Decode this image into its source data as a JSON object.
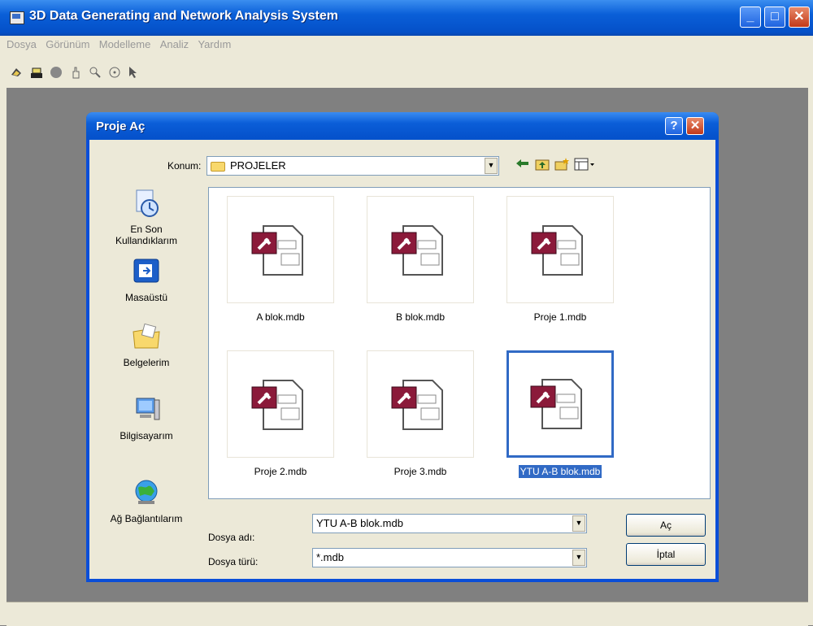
{
  "app": {
    "title": "3D Data Generating and Network Analysis System",
    "menu": [
      "Dosya",
      "Görünüm",
      "Modelleme",
      "Analiz",
      "Yardım"
    ],
    "window_buttons": {
      "minimize": "_",
      "maximize": "□",
      "close": "✕"
    }
  },
  "toolbar": {
    "icons": [
      "open-project-icon",
      "table-icon",
      "stop-icon",
      "pan-icon",
      "zoom-icon",
      "target-icon",
      "pointer-icon"
    ]
  },
  "dialog": {
    "title": "Proje Aç",
    "help_label": "?",
    "close_label": "✕",
    "location_label": "Konum:",
    "location_value": "PROJELER",
    "places": [
      {
        "label1": "En Son",
        "label2": "Kullandıklarım",
        "icon": "recent-icon"
      },
      {
        "label1": "Masaüstü",
        "label2": "",
        "icon": "desktop-icon"
      },
      {
        "label1": "Belgelerim",
        "label2": "",
        "icon": "my-documents-icon"
      },
      {
        "label1": "Bilgisayarım",
        "label2": "",
        "icon": "my-computer-icon"
      },
      {
        "label1": "Ağ Bağlantılarım",
        "label2": "",
        "icon": "network-icon"
      }
    ],
    "files": [
      {
        "name": "A blok.mdb",
        "selected": false
      },
      {
        "name": "B blok.mdb",
        "selected": false
      },
      {
        "name": "Proje 1.mdb",
        "selected": false
      },
      {
        "name": "Proje 2.mdb",
        "selected": false
      },
      {
        "name": "Proje 3.mdb",
        "selected": false
      },
      {
        "name": "YTU A-B blok.mdb",
        "selected": true
      }
    ],
    "filename_label": "Dosya adı:",
    "filename_value": "YTU A-B blok.mdb",
    "filetype_label": "Dosya türü:",
    "filetype_value": "*.mdb",
    "open_button": "Aç",
    "cancel_button": "İptal",
    "colors": {
      "selection": "#316ac5",
      "access_icon": "#8b1a3a"
    }
  }
}
